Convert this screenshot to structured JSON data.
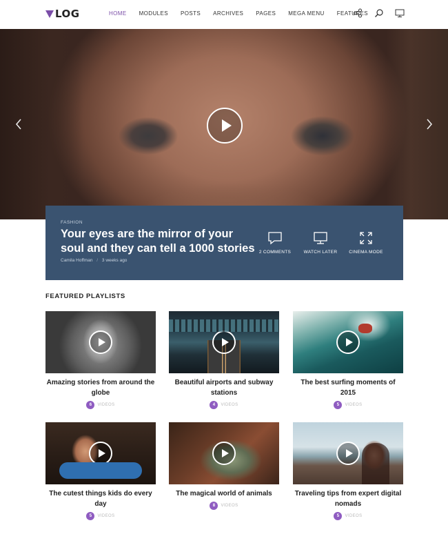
{
  "header": {
    "logo_text": "LOG",
    "nav": [
      {
        "label": "HOME",
        "active": true
      },
      {
        "label": "MODULES",
        "active": false
      },
      {
        "label": "POSTS",
        "active": false
      },
      {
        "label": "ARCHIVES",
        "active": false
      },
      {
        "label": "PAGES",
        "active": false
      },
      {
        "label": "MEGA MENU",
        "active": false
      },
      {
        "label": "FEATURES",
        "active": false
      }
    ],
    "icons": [
      "share-icon",
      "search-icon",
      "monitor-icon"
    ]
  },
  "hero": {
    "icons": [
      "play-icon",
      "chevron-left-icon",
      "chevron-right-icon"
    ]
  },
  "featured": {
    "category": "FASHION",
    "title": "Your eyes are the mirror of your soul and they can tell a 1000 stories",
    "author": "Camila Hoffman",
    "time": "3 weeks ago",
    "actions": [
      {
        "label": "2 COMMENTS",
        "icon": "comment-icon"
      },
      {
        "label": "WATCH LATER",
        "icon": "monitor-icon"
      },
      {
        "label": "CINEMA MODE",
        "icon": "expand-icon"
      }
    ]
  },
  "playlists": {
    "section_title": "FEATURED PLAYLISTS",
    "videos_label": "VIDEOS",
    "items": [
      {
        "title": "Amazing stories from around the globe",
        "count": "6"
      },
      {
        "title": "Beautiful airports and subway stations",
        "count": "4"
      },
      {
        "title": "The best surfing moments of 2015",
        "count": "5"
      },
      {
        "title": "The cutest things kids do every day",
        "count": "5"
      },
      {
        "title": "The magical world of animals",
        "count": "8"
      },
      {
        "title": "Traveling tips from expert digital nomads",
        "count": "5"
      }
    ]
  },
  "colors": {
    "accent": "#7b4ea8",
    "badge": "#8f5cc1",
    "feature_box": "#3a5370"
  }
}
